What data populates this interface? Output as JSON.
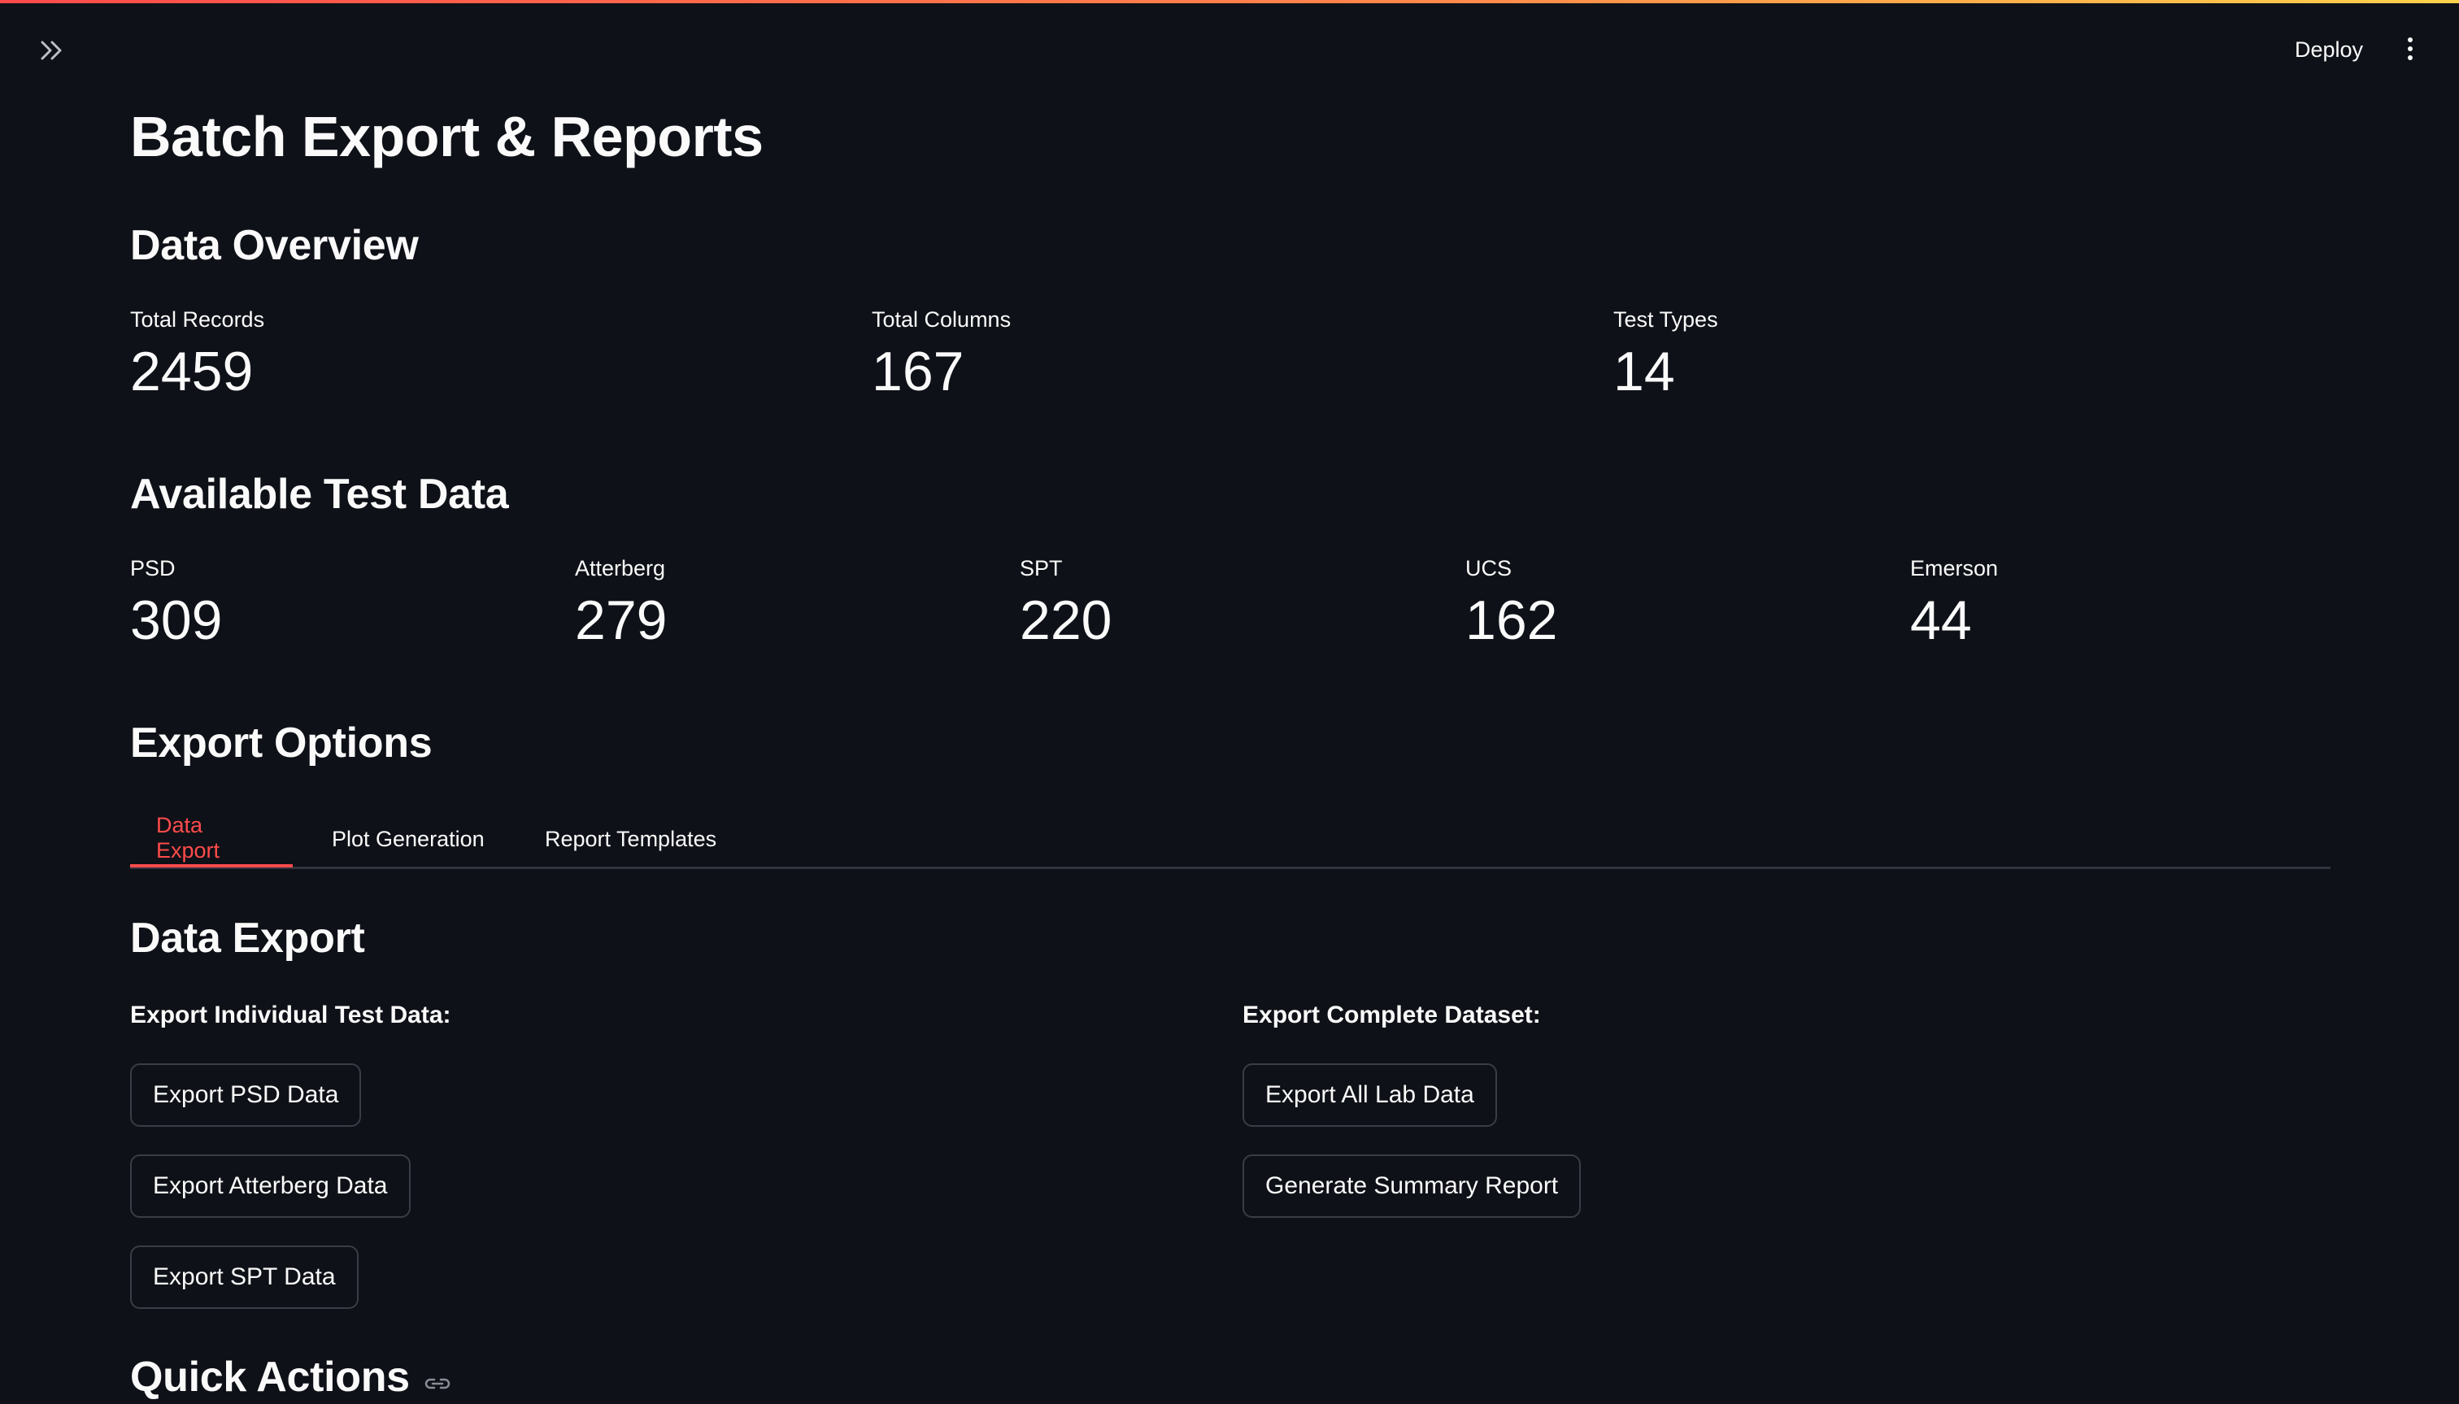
{
  "header": {
    "deploy_label": "Deploy"
  },
  "page": {
    "title": "Batch Export & Reports"
  },
  "data_overview": {
    "heading": "Data Overview",
    "metrics": [
      {
        "label": "Total Records",
        "value": "2459"
      },
      {
        "label": "Total Columns",
        "value": "167"
      },
      {
        "label": "Test Types",
        "value": "14"
      }
    ]
  },
  "available_tests": {
    "heading": "Available Test Data",
    "metrics": [
      {
        "label": "PSD",
        "value": "309"
      },
      {
        "label": "Atterberg",
        "value": "279"
      },
      {
        "label": "SPT",
        "value": "220"
      },
      {
        "label": "UCS",
        "value": "162"
      },
      {
        "label": "Emerson",
        "value": "44"
      }
    ]
  },
  "export_options": {
    "heading": "Export Options",
    "tabs": [
      {
        "label": "Data Export",
        "active": true
      },
      {
        "label": "Plot Generation",
        "active": false
      },
      {
        "label": "Report Templates",
        "active": false
      }
    ]
  },
  "data_export": {
    "heading": "Data Export",
    "individual_label": "Export Individual Test Data:",
    "complete_label": "Export Complete Dataset:",
    "individual_buttons": [
      "Export PSD Data",
      "Export Atterberg Data",
      "Export SPT Data"
    ],
    "complete_buttons": [
      "Export All Lab Data",
      "Generate Summary Report"
    ]
  },
  "quick_actions": {
    "heading": "Quick Actions"
  },
  "colors": {
    "background": "#0e1117",
    "accent": "#ff4b4b",
    "border": "#3a3d48"
  }
}
